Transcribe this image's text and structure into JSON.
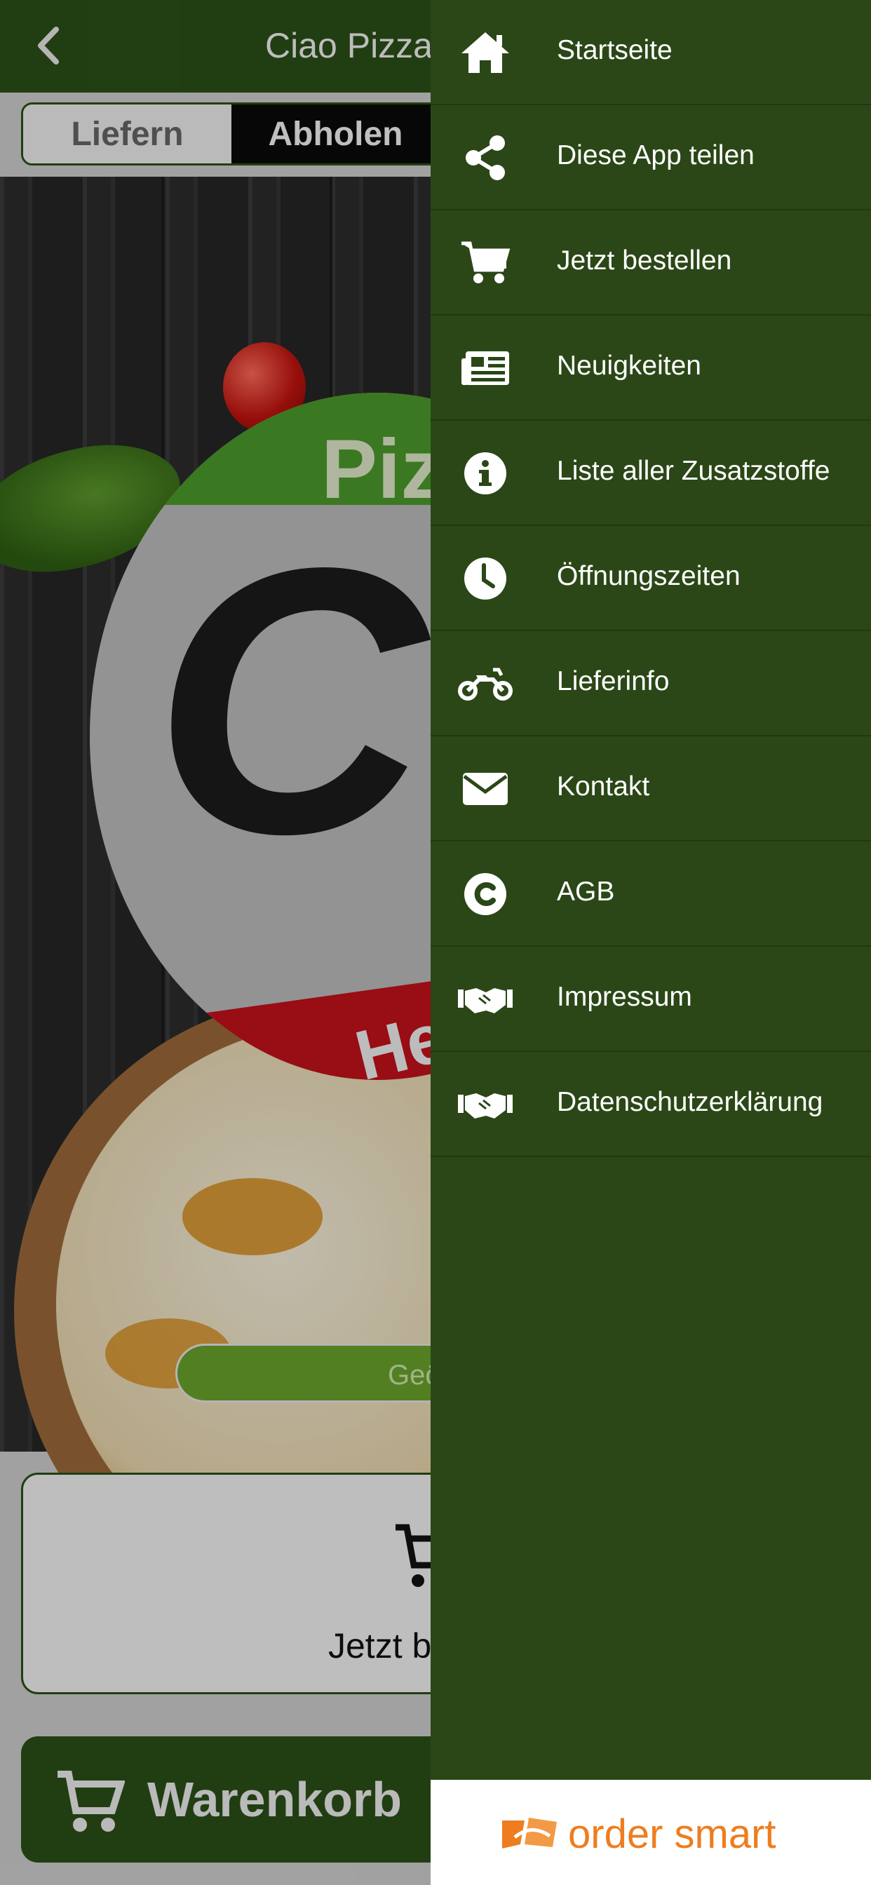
{
  "app": {
    "title": "Ciao Pizza I",
    "toggle": {
      "left_label": "Liefern",
      "right_label": "Abholen"
    },
    "logo_top_text": "Piz",
    "logo_main_text": "Ci",
    "logo_bottom_text": "He",
    "open_status_text": "Geö",
    "order_button_label": "Jetzt b",
    "cart_label": "Warenkorb"
  },
  "drawer": {
    "items": [
      {
        "label": "Startseite",
        "icon": "home-icon"
      },
      {
        "label": "Diese App teilen",
        "icon": "share-icon"
      },
      {
        "label": "Jetzt bestellen",
        "icon": "cart-icon"
      },
      {
        "label": "Neuigkeiten",
        "icon": "newspaper-icon"
      },
      {
        "label": "Liste aller Zusatzstoffe",
        "icon": "info-icon"
      },
      {
        "label": "Öffnungszeiten",
        "icon": "clock-icon"
      },
      {
        "label": "Lieferinfo",
        "icon": "motorcycle-icon"
      },
      {
        "label": "Kontakt",
        "icon": "envelope-icon"
      },
      {
        "label": "AGB",
        "icon": "copyright-icon"
      },
      {
        "label": "Impressum",
        "icon": "handshake-icon"
      },
      {
        "label": "Datenschutzerklärung",
        "icon": "handshake-icon"
      }
    ],
    "footer_brand": "order smart"
  },
  "colors": {
    "header_green": "#2b5018",
    "drawer_green": "#2b4717",
    "brand_orange": "#ee7d1f",
    "open_pill_green": "#6aa32c"
  }
}
